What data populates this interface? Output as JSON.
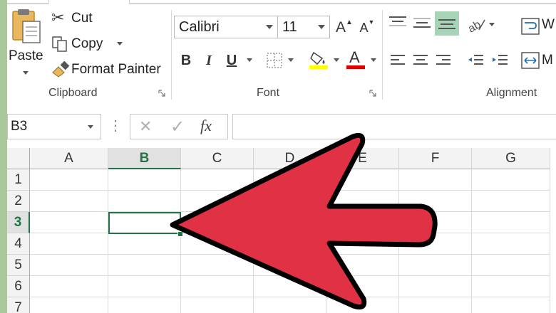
{
  "colors": {
    "accent": "#217346",
    "arrow_fill": "#e03244",
    "arrow_stroke": "#000000",
    "page_bg": "#a9c89a"
  },
  "clipboard": {
    "paste_label": "Paste",
    "cut_label": "Cut",
    "copy_label": "Copy",
    "format_painter_label": "Format Painter",
    "group_title": "Clipboard"
  },
  "font": {
    "font_name": "Calibri",
    "font_size": "11",
    "grow_label": "A",
    "shrink_label": "A",
    "bold_label": "B",
    "italic_label": "I",
    "underline_label": "U",
    "font_color_label": "A",
    "group_title": "Font"
  },
  "alignment": {
    "group_title": "Alignment"
  },
  "formula_bar": {
    "name_box": "B3",
    "cancel_symbol": "✕",
    "enter_symbol": "✓",
    "fx_label": "fx",
    "formula_value": ""
  },
  "sheet": {
    "columns": [
      "A",
      "B",
      "C",
      "D",
      "E",
      "F",
      "G"
    ],
    "rows": [
      "1",
      "2",
      "3",
      "4",
      "5",
      "6",
      "7"
    ],
    "selected_column": "B",
    "selected_row": "3"
  }
}
